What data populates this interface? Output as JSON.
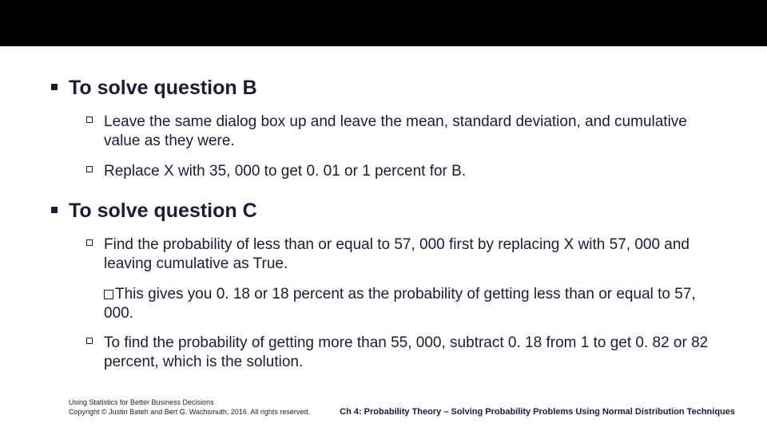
{
  "sections": [
    {
      "heading": "To solve question B",
      "items": [
        {
          "text": "Leave the same dialog box up and leave the mean, standard deviation, and cumulative value as they were."
        },
        {
          "text": "Replace X with 35, 000 to get 0. 01 or 1 percent for B."
        }
      ]
    },
    {
      "heading": "To solve question C",
      "items": [
        {
          "text": "Find the probability of less than or equal to 57, 000 first by replacing X with 57, 000 and leaving cumulative as True."
        },
        {
          "text": "This gives you 0. 18 or 18 percent as the probability of getting less than or equal to 57, 000.",
          "glyph": true,
          "noMarker": true
        },
        {
          "text": "To find the probability of getting more than 55, 000, subtract 0. 18 from 1 to get 0. 82 or 82 percent, which is the solution."
        }
      ]
    }
  ],
  "footer": {
    "line1": "Using Statistics for Better Business Decisions",
    "line2": "Copyright © Justin Bateh and Bert G. Wachsmuth, 2016. All rights reserved.",
    "right": "Ch 4: Probability Theory – Solving Probability Problems Using Normal Distribution Techniques"
  }
}
